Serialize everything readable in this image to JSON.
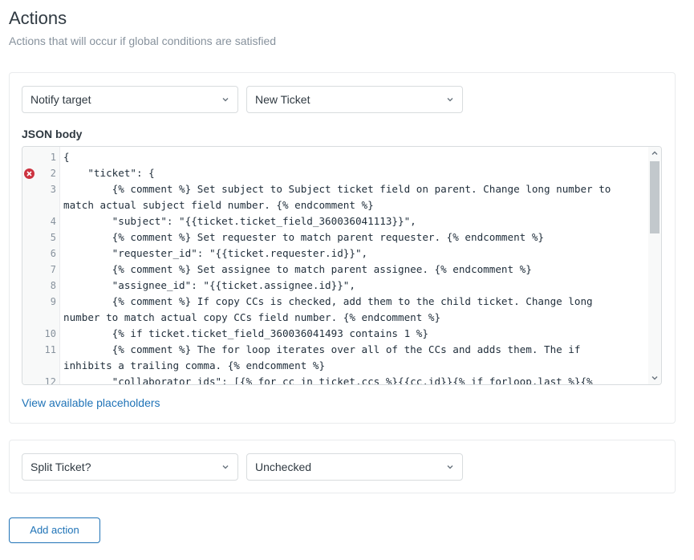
{
  "section": {
    "title": "Actions",
    "subtitle": "Actions that will occur if global conditions are satisfied"
  },
  "action1": {
    "field": "Notify target",
    "target": "New Ticket",
    "json_label": "JSON body",
    "code_lines": [
      {
        "n": "1",
        "text": "{"
      },
      {
        "n": "2",
        "text": "    \"ticket\": {",
        "error": true
      },
      {
        "n": "3",
        "text": "        {% comment %} Set subject to Subject ticket field on parent. Change long number to"
      },
      {
        "n": "",
        "text": "match actual subject field number. {% endcomment %}"
      },
      {
        "n": "4",
        "text": "        \"subject\": \"{{ticket.ticket_field_360036041113}}\","
      },
      {
        "n": "5",
        "text": "        {% comment %} Set requester to match parent requester. {% endcomment %}"
      },
      {
        "n": "6",
        "text": "        \"requester_id\": \"{{ticket.requester.id}}\","
      },
      {
        "n": "7",
        "text": "        {% comment %} Set assignee to match parent assignee. {% endcomment %}"
      },
      {
        "n": "8",
        "text": "        \"assignee_id\": \"{{ticket.assignee.id}}\","
      },
      {
        "n": "9",
        "text": "        {% comment %} If copy CCs is checked, add them to the child ticket. Change long"
      },
      {
        "n": "",
        "text": "number to match actual copy CCs field number. {% endcomment %}"
      },
      {
        "n": "10",
        "text": "        {% if ticket.ticket_field_360036041493 contains 1 %}"
      },
      {
        "n": "11",
        "text": "        {% comment %} The for loop iterates over all of the CCs and adds them. The if"
      },
      {
        "n": "",
        "text": "inhibits a trailing comma. {% endcomment %}"
      },
      {
        "n": "12",
        "text": "        \"collaborator_ids\": [{% for cc in ticket.ccs %}{{cc.id}}{% if forloop.last %}{%"
      }
    ],
    "placeholders_link": "View available placeholders"
  },
  "action2": {
    "field": "Split Ticket?",
    "value": "Unchecked"
  },
  "add_action_label": "Add action",
  "colors": {
    "accent": "#1f73b7",
    "error": "#cc3340",
    "border": "#d8dcde"
  }
}
